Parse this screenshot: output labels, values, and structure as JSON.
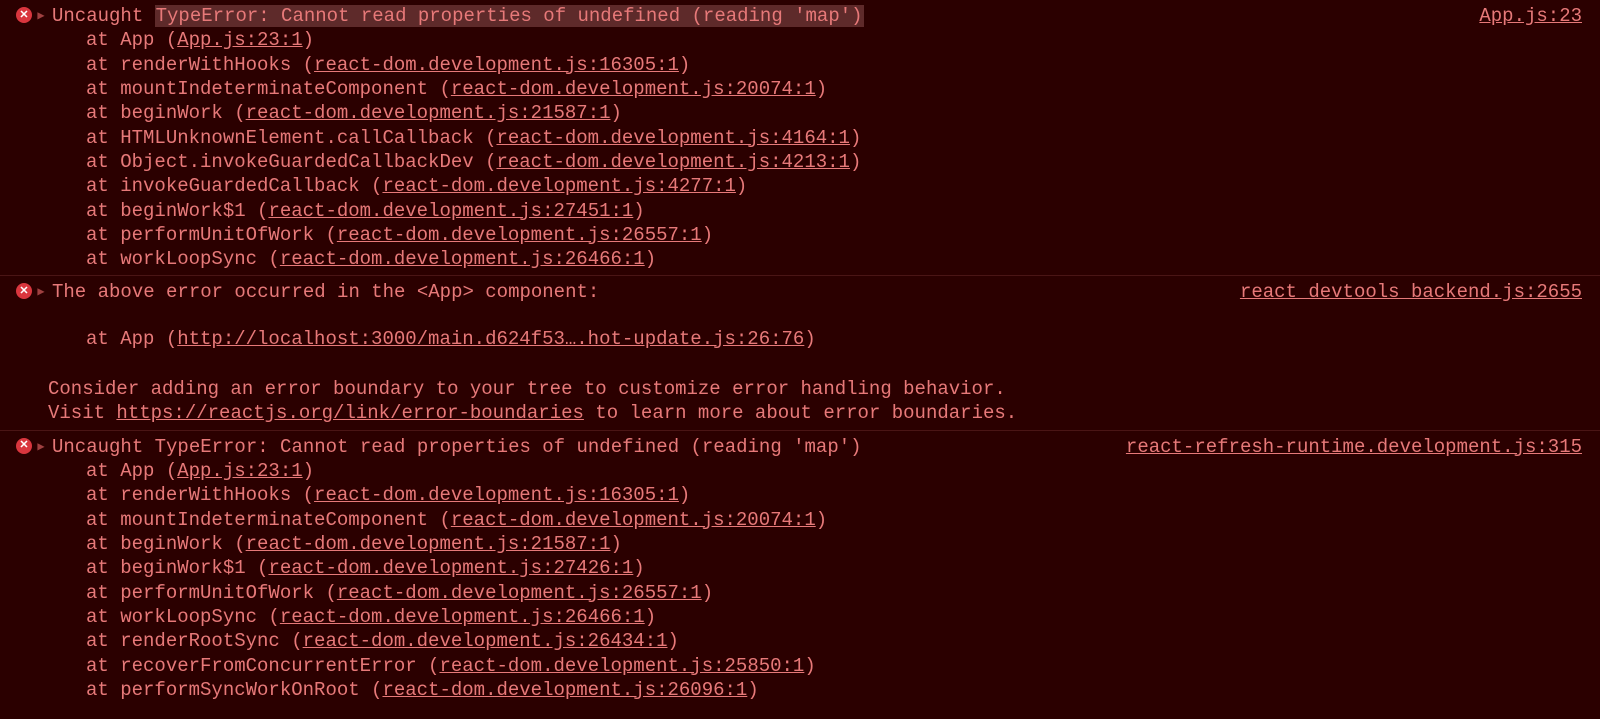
{
  "errors": [
    {
      "prefix": "Uncaught",
      "highlighted": "TypeError: Cannot read properties of undefined (reading 'map')",
      "source": "App.js:23",
      "trace": [
        {
          "fn": "App",
          "loc": "App.js:23:1"
        },
        {
          "fn": "renderWithHooks",
          "loc": "react-dom.development.js:16305:1"
        },
        {
          "fn": "mountIndeterminateComponent",
          "loc": "react-dom.development.js:20074:1"
        },
        {
          "fn": "beginWork",
          "loc": "react-dom.development.js:21587:1"
        },
        {
          "fn": "HTMLUnknownElement.callCallback",
          "loc": "react-dom.development.js:4164:1"
        },
        {
          "fn": "Object.invokeGuardedCallbackDev",
          "loc": "react-dom.development.js:4213:1"
        },
        {
          "fn": "invokeGuardedCallback",
          "loc": "react-dom.development.js:4277:1"
        },
        {
          "fn": "beginWork$1",
          "loc": "react-dom.development.js:27451:1"
        },
        {
          "fn": "performUnitOfWork",
          "loc": "react-dom.development.js:26557:1"
        },
        {
          "fn": "workLoopSync",
          "loc": "react-dom.development.js:26466:1"
        }
      ]
    },
    {
      "message": "The above error occurred in the <App> component:",
      "source": "react_devtools_backend.js:2655",
      "trace": [
        {
          "fn": "App",
          "loc": "http://localhost:3000/main.d624f53….hot-update.js:26:76"
        }
      ],
      "advice_line1": "Consider adding an error boundary to your tree to customize error handling behavior.",
      "advice_prefix": "Visit ",
      "advice_link": "https://reactjs.org/link/error-boundaries",
      "advice_suffix": " to learn more about error boundaries."
    },
    {
      "message": "Uncaught TypeError: Cannot read properties of undefined (reading 'map')",
      "source": "react-refresh-runtime.development.js:315",
      "trace": [
        {
          "fn": "App",
          "loc": "App.js:23:1"
        },
        {
          "fn": "renderWithHooks",
          "loc": "react-dom.development.js:16305:1"
        },
        {
          "fn": "mountIndeterminateComponent",
          "loc": "react-dom.development.js:20074:1"
        },
        {
          "fn": "beginWork",
          "loc": "react-dom.development.js:21587:1"
        },
        {
          "fn": "beginWork$1",
          "loc": "react-dom.development.js:27426:1"
        },
        {
          "fn": "performUnitOfWork",
          "loc": "react-dom.development.js:26557:1"
        },
        {
          "fn": "workLoopSync",
          "loc": "react-dom.development.js:26466:1"
        },
        {
          "fn": "renderRootSync",
          "loc": "react-dom.development.js:26434:1"
        },
        {
          "fn": "recoverFromConcurrentError",
          "loc": "react-dom.development.js:25850:1"
        },
        {
          "fn": "performSyncWorkOnRoot",
          "loc": "react-dom.development.js:26096:1"
        }
      ]
    }
  ]
}
